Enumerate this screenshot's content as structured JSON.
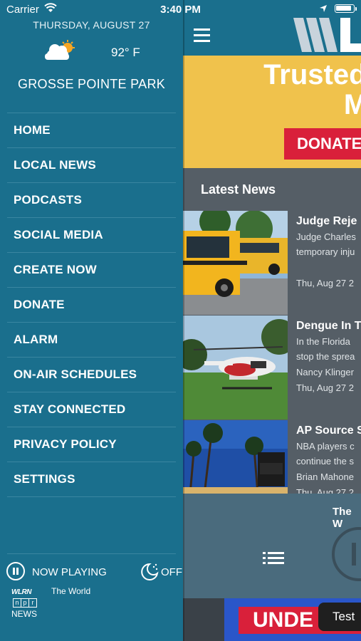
{
  "status_bar": {
    "carrier": "Carrier",
    "time": "3:40 PM"
  },
  "drawer": {
    "date": "THURSDAY, AUGUST 27",
    "weather": {
      "icon": "partly-cloudy-icon",
      "temperature": "92° F"
    },
    "city": "GROSSE POINTE PARK",
    "menu": [
      {
        "label": "HOME"
      },
      {
        "label": "LOCAL NEWS"
      },
      {
        "label": "PODCASTS"
      },
      {
        "label": "SOCIAL MEDIA"
      },
      {
        "label": "CREATE NOW"
      },
      {
        "label": "DONATE"
      },
      {
        "label": "ALARM"
      },
      {
        "label": "ON-AIR SCHEDULES"
      },
      {
        "label": "STAY CONNECTED"
      },
      {
        "label": "PRIVACY POLICY"
      },
      {
        "label": "SETTINGS"
      }
    ],
    "player": {
      "now_playing_label": "NOW PLAYING",
      "sleep_label": "OFF",
      "station": {
        "name": "WLRN",
        "network": "npr",
        "news": "NEWS"
      },
      "program": "The World"
    }
  },
  "main": {
    "banner": {
      "headline_line1": "Trusted J",
      "headline_line2": "Matt",
      "donate_label": "DONATE"
    },
    "section_title": "Latest News",
    "articles": [
      {
        "title": "Judge Reje",
        "lines": [
          "Judge Charles",
          "temporary inju"
        ],
        "date": "Thu, Aug 27 2"
      },
      {
        "title": "Dengue In T",
        "lines": [
          "In the Florida",
          "stop the sprea",
          "Nancy Klinger"
        ],
        "date": "Thu, Aug 27 2"
      },
      {
        "title": "AP Source S",
        "lines": [
          "NBA players c",
          "continue the s",
          "Brian Mahone"
        ],
        "date": "Thu, Aug 27 2"
      }
    ],
    "mini_player": {
      "label": "The W"
    },
    "bottom_ad": {
      "text": "UNDE",
      "tooltip": "Test"
    }
  },
  "colors": {
    "drawer_bg": "#1a6f8d",
    "banner_bg": "#f0c24c",
    "donate_red": "#d9203a",
    "content_bg": "#555e66"
  }
}
